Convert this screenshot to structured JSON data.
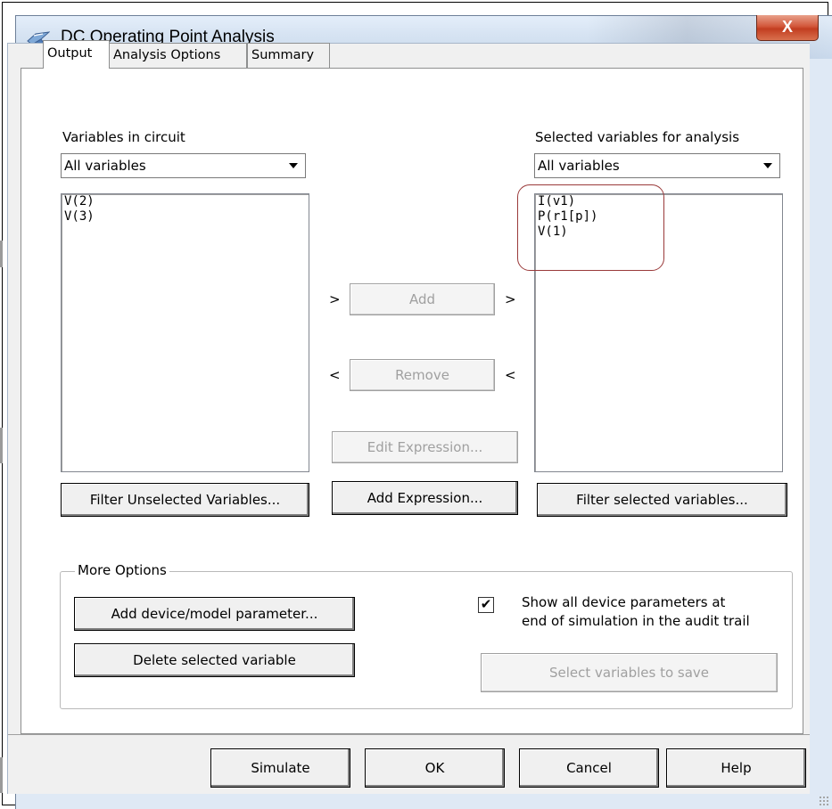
{
  "window": {
    "title": "DC Operating Point Analysis",
    "close_label": "X"
  },
  "tabs": [
    {
      "label": "Output",
      "active": true
    },
    {
      "label": "Analysis Options",
      "active": false
    },
    {
      "label": "Summary",
      "active": false
    }
  ],
  "left": {
    "label": "Variables in circuit",
    "filter_value": "All variables",
    "items": [
      "V(2)",
      "V(3)"
    ],
    "filter_button": "Filter Unselected Variables..."
  },
  "right": {
    "label": "Selected variables for analysis",
    "filter_value": "All variables",
    "items": [
      "I(v1)",
      "P(r1[p])",
      "V(1)"
    ],
    "filter_button": "Filter selected variables..."
  },
  "middle": {
    "add": {
      "label": "Add",
      "left_chevron": ">",
      "right_chevron": ">"
    },
    "remove": {
      "label": "Remove",
      "left_chevron": "<",
      "right_chevron": "<"
    },
    "edit_expression": "Edit Expression...",
    "add_expression": "Add Expression..."
  },
  "more_options": {
    "legend": "More Options",
    "add_param_button": "Add device/model parameter...",
    "delete_var_button": "Delete selected variable",
    "show_params_checked": true,
    "show_params_line1": "Show all device parameters at",
    "show_params_line2": "end of simulation in the audit trail",
    "select_vars_button": "Select variables to save"
  },
  "footer": {
    "simulate": "Simulate",
    "ok": "OK",
    "cancel": "Cancel",
    "help": "Help"
  },
  "colors": {
    "titlebar": "#d6e3f2",
    "close": "#c23d20",
    "highlight_outline": "#9a3a3a",
    "disabled_text": "#a0a0a0"
  }
}
